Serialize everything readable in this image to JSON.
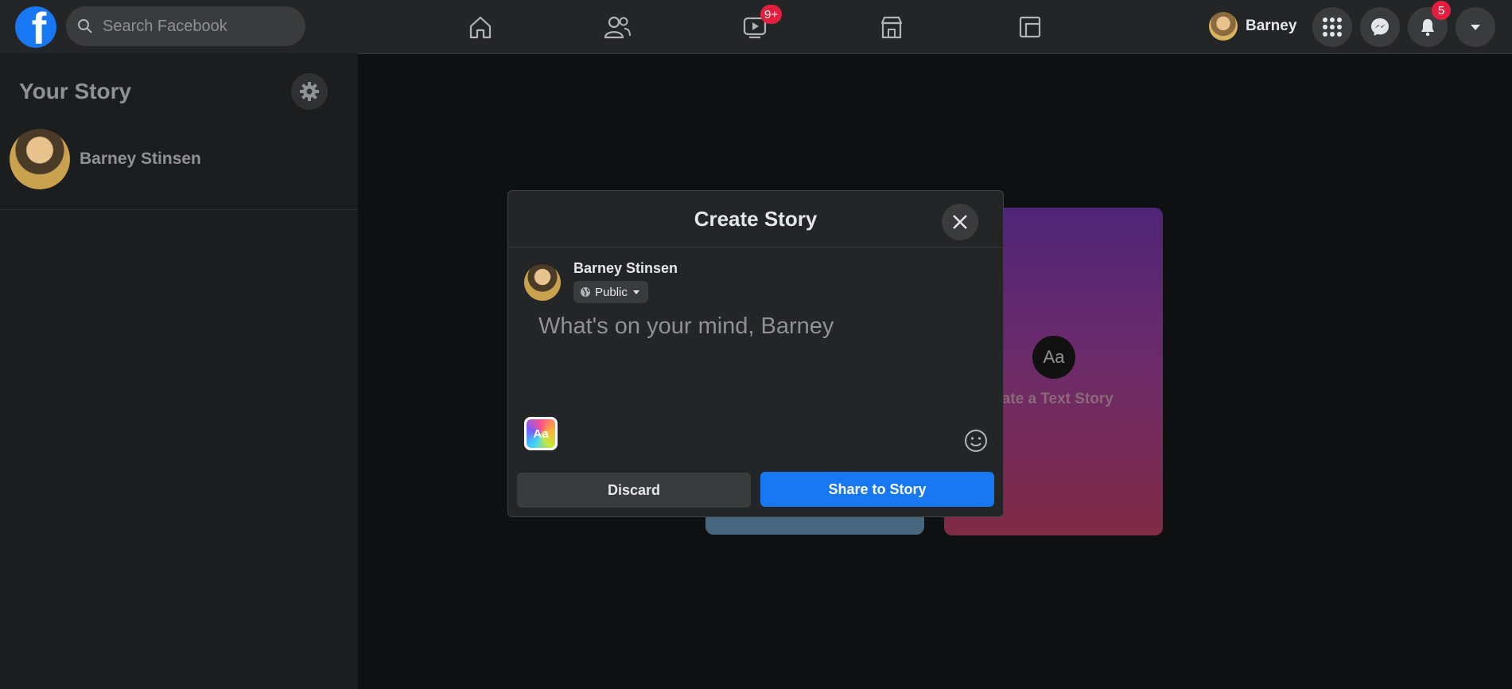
{
  "topbar": {
    "logo_letter": "f",
    "search_placeholder": "Search Facebook",
    "nav": [
      {
        "name": "home-icon"
      },
      {
        "name": "friends-icon"
      },
      {
        "name": "watch-icon",
        "badge": "9+"
      },
      {
        "name": "marketplace-icon"
      },
      {
        "name": "groups-icon"
      }
    ],
    "profile_name": "Barney",
    "notifications_badge": "5",
    "colors": {
      "brand": "#1877f2",
      "badge": "#e41e3f",
      "bar": "#242526"
    }
  },
  "sidebar": {
    "title": "Your Story",
    "user_name": "Barney Stinsen"
  },
  "background_cards": {
    "text_card_icon": "Aa",
    "text_card_label": "eate a Text Story"
  },
  "modal": {
    "title": "Create Story",
    "author": "Barney Stinsen",
    "privacy": "Public",
    "placeholder": "What's on your mind, Barney",
    "bg_picker_label": "Aa",
    "discard_label": "Discard",
    "share_label": "Share to Story"
  }
}
